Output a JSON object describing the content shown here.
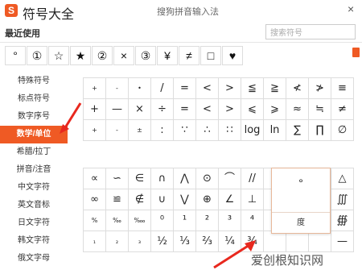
{
  "app": {
    "title": "符号大全",
    "ime_name": "搜狗拼音输入法",
    "close": "×"
  },
  "recent": {
    "title": "最近使用",
    "symbols": [
      "°",
      "①",
      "☆",
      "★",
      "②",
      "×",
      "③",
      "¥",
      "≠",
      "□",
      "♥"
    ]
  },
  "search": {
    "placeholder": "搜索符号"
  },
  "sidebar": {
    "items": [
      {
        "label": "特殊符号",
        "active": false
      },
      {
        "label": "标点符号",
        "active": false
      },
      {
        "label": "数字序号",
        "active": false
      },
      {
        "label": "数学/单位",
        "active": true
      },
      {
        "label": "希腊/拉丁",
        "active": false
      },
      {
        "label": "拼音/注音",
        "active": false
      },
      {
        "label": "中文字符",
        "active": false
      },
      {
        "label": "英文音标",
        "active": false
      },
      {
        "label": "日文字符",
        "active": false
      },
      {
        "label": "韩文字符",
        "active": false
      },
      {
        "label": "俄文字母",
        "active": false
      }
    ]
  },
  "math_grid": {
    "rows": [
      [
        "+",
        "-",
        "•",
        "/",
        "=",
        "<",
        ">",
        "≦",
        "≧",
        "≮",
        "≯",
        "≡"
      ],
      [
        "+",
        "—",
        "×",
        "÷",
        "=",
        "<",
        ">",
        "⩽",
        "⩾",
        "≈",
        "≒",
        "≠"
      ],
      [
        "+",
        "-",
        "±",
        ":",
        "∵",
        "∴",
        "∷",
        "log",
        "ln",
        "∑",
        "∏",
        "∅"
      ]
    ]
  },
  "unit_grid": {
    "rows": [
      [
        "∝",
        "∽",
        "∈",
        "∩",
        "⋀",
        "⊙",
        "⌒",
        "//",
        "",
        "",
        "",
        "△"
      ],
      [
        "∞",
        "≌",
        "∉",
        "∪",
        "⋁",
        "⊕",
        "∠",
        "⊥",
        "",
        "",
        "",
        "∭"
      ],
      [
        "%",
        "‰",
        "‱",
        "⁰",
        "¹",
        "²",
        "³",
        "⁴",
        "",
        "",
        "",
        "∰"
      ],
      [
        "₁",
        "₂",
        "₃",
        "½",
        "⅓",
        "⅔",
        "¼",
        "¾",
        "",
        "",
        "",
        "—"
      ]
    ]
  },
  "popup": {
    "symbol": "°",
    "label": "度"
  },
  "watermark": {
    "text": "爱创根知识网"
  },
  "colors": {
    "accent": "#ef5a24"
  }
}
